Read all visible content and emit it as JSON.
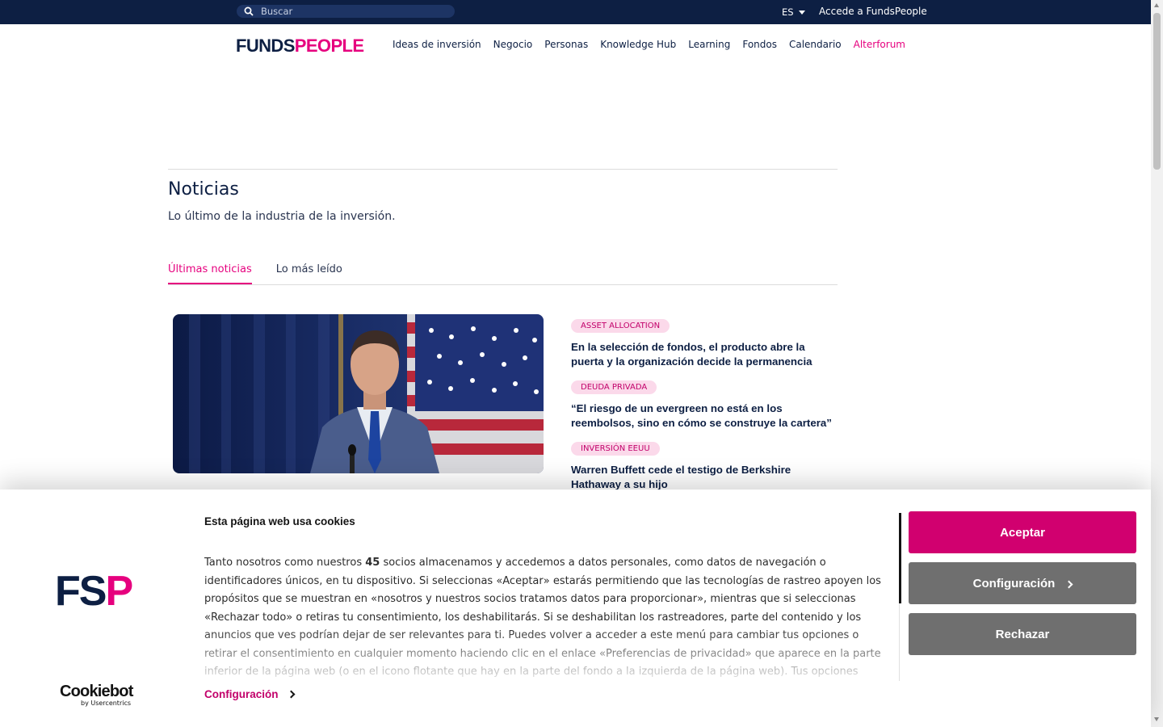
{
  "topbar": {
    "search_placeholder": "Buscar",
    "language": "ES",
    "access_link": "Accede a FundsPeople"
  },
  "logo": {
    "part1": "FUNDS",
    "part2": "PEOPLE"
  },
  "nav": {
    "items": [
      "Ideas de inversión",
      "Negocio",
      "Personas",
      "Knowledge Hub",
      "Learning",
      "Fondos",
      "Calendario",
      "Alterforum"
    ]
  },
  "page": {
    "title": "Noticias",
    "subtitle": "Lo último de la industria de la inversión."
  },
  "tabs": {
    "latest": "Últimas noticias",
    "most_read": "Lo más leído"
  },
  "articles": [
    {
      "tag": "ASSET ALLOCATION",
      "title": "En la selección de fondos, el producto abre la puerta y la organización decide la permanencia"
    },
    {
      "tag": "DEUDA PRIVADA",
      "title": "“El riesgo de un evergreen no está en los reembolsos, sino en cómo se construye la cartera”"
    },
    {
      "tag": "INVERSIÓN EEUU",
      "title": "Warren Buffett cede el testigo de Berkshire Hathaway a su hijo"
    }
  ],
  "cookie": {
    "logo_part1": "FS",
    "logo_part2": "P",
    "cookiebot_brand": "Cookiebot",
    "cookiebot_by": "by Usercentrics",
    "title": "Esta página web usa cookies",
    "body_before": "Tanto nosotros como nuestros ",
    "partners_count": "45",
    "body_after": " socios almacenamos y accedemos a datos personales, como datos de navegación o identificadores únicos, en tu dispositivo. Si seleccionas «Aceptar» estarás permitiendo que las tecnologías de rastreo apoyen los propósitos que se muestran en «nosotros y nuestros socios tratamos datos para proporcionar», mientras que si seleccionas «Rechazar todo» o retiras tu consentimiento, los deshabilitarás. Si se deshabilitan los rastreadores, parte del contenido y los anuncios que ves podrían dejar de ser relevantes para ti. Puedes volver a acceder a este menú para cambiar tus opciones o retirar el consentimiento en cualquier momento haciendo clic en el enlace «Preferencias de privacidad» que aparece en la parte inferior de la página web (o en el icono flotante que hay en la parte del fondo a la izquierda de la página web). Tus opciones",
    "config_link": "Configuración",
    "accept": "Aceptar",
    "configure": "Configuración",
    "reject": "Rechazar"
  },
  "colors": {
    "navy": "#0d1f43",
    "pink": "#e6007e",
    "accept_button": "#d1006f",
    "secondary_button": "#6f6f6f"
  }
}
